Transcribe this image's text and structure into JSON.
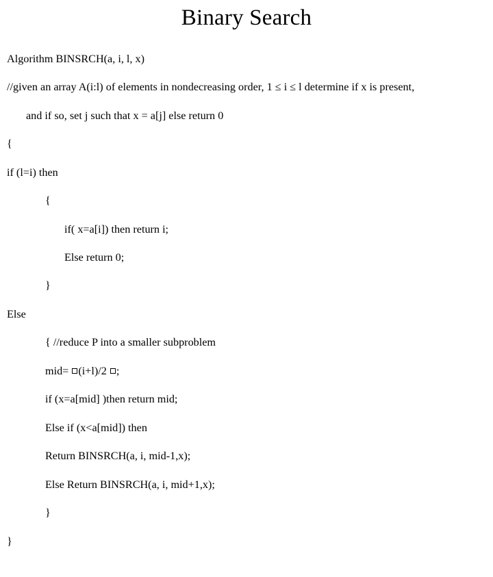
{
  "title": "Binary Search",
  "code": {
    "l01": "Algorithm BINSRCH(a, i, l, x)",
    "l02": "//given an array A(i:l) of elements in nondecreasing order, 1 ≤ i ≤ l determine if x is present,",
    "l03": "and if so, set j such that x = a[j] else return 0",
    "l04": "{",
    "l05": "if (l=i) then",
    "l06": "{",
    "l07": "if( x=a[i]) then return i;",
    "l08": "Else return 0;",
    "l09": "}",
    "l10": "Else",
    "l11": "{ //reduce P into a smaller subproblem",
    "mid_a": "mid= ",
    "mid_b": "(i+l)/2 ",
    "mid_c": ";",
    "l13": "if (x=a[mid] )then return mid;",
    "l14": "Else if (x<a[mid]) then",
    "l15": "Return BINSRCH(a, i, mid-1,x);",
    "l16": "Else Return BINSRCH(a, i, mid+1,x);",
    "l17": "}",
    "l18": "}"
  }
}
